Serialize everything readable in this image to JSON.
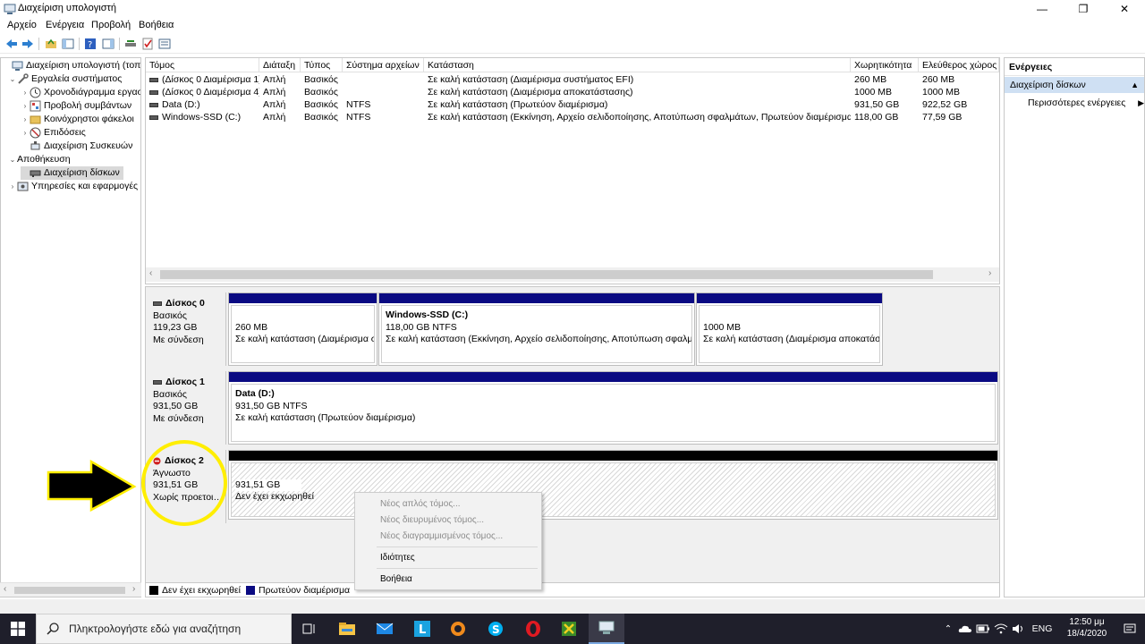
{
  "window": {
    "title": "Διαχείριση υπολογιστή"
  },
  "menu": [
    "Αρχείο",
    "Ενέργεια",
    "Προβολή",
    "Βοήθεια"
  ],
  "tree": {
    "items": [
      {
        "label": "Διαχείριση υπολογιστή (τοπικά)",
        "level": 0,
        "exp": ""
      },
      {
        "label": "Εργαλεία συστήματος",
        "level": 1,
        "exp": "⌄"
      },
      {
        "label": "Χρονοδιάγραμμα εργασιών",
        "level": 2,
        "exp": "›"
      },
      {
        "label": "Προβολή συμβάντων",
        "level": 2,
        "exp": "›"
      },
      {
        "label": "Κοινόχρηστοι φάκελοι",
        "level": 2,
        "exp": "›"
      },
      {
        "label": "Επιδόσεις",
        "level": 2,
        "exp": "›"
      },
      {
        "label": "Διαχείριση Συσκευών",
        "level": 2,
        "exp": ""
      },
      {
        "label": "Αποθήκευση",
        "level": 1,
        "exp": "⌄"
      },
      {
        "label": "Διαχείριση δίσκων",
        "level": 2,
        "exp": "",
        "selected": true
      },
      {
        "label": "Υπηρεσίες και εφαρμογές",
        "level": 1,
        "exp": "›"
      }
    ]
  },
  "volumes": {
    "columns": [
      "Τόμος",
      "Διάταξη",
      "Τύπος",
      "Σύστημα αρχείων",
      "Κατάσταση",
      "Χωρητικότητα",
      "Ελεύθερος χώρος"
    ],
    "rows": [
      [
        "(Δίσκος 0 Διαμέρισμα 1)",
        "Απλή",
        "Βασικός",
        "",
        "Σε καλή κατάσταση (Διαμέρισμα συστήματος EFI)",
        "260 MB",
        "260 MB"
      ],
      [
        "(Δίσκος 0 Διαμέρισμα 4)",
        "Απλή",
        "Βασικός",
        "",
        "Σε καλή κατάσταση (Διαμέρισμα αποκατάστασης)",
        "1000 MB",
        "1000 MB"
      ],
      [
        "Data (D:)",
        "Απλή",
        "Βασικός",
        "NTFS",
        "Σε καλή κατάσταση (Πρωτεύον διαμέρισμα)",
        "931,50 GB",
        "922,52 GB"
      ],
      [
        "Windows-SSD (C:)",
        "Απλή",
        "Βασικός",
        "NTFS",
        "Σε καλή κατάσταση (Εκκίνηση, Αρχείο σελιδοποίησης, Αποτύπωση σφαλμάτων, Πρωτεύον διαμέρισμα)",
        "118,00 GB",
        "77,59 GB"
      ]
    ]
  },
  "disks": [
    {
      "name": "Δίσκος 0",
      "type": "Βασικός",
      "size": "119,23 GB",
      "status": "Με σύνδεση",
      "partitions": [
        {
          "name": "",
          "size": "260 MB",
          "status": "Σε καλή κατάσταση (Διαμέρισμα συστήματος EFI)"
        },
        {
          "name": "Windows-SSD  (C:)",
          "size": "118,00 GB NTFS",
          "status": "Σε καλή κατάσταση (Εκκίνηση, Αρχείο σελιδοποίησης, Αποτύπωση σφαλμάτων, Πρωτεύον διαμέρισμα)"
        },
        {
          "name": "",
          "size": "1000 MB",
          "status": "Σε καλή κατάσταση (Διαμέρισμα αποκατάστασης)"
        }
      ]
    },
    {
      "name": "Δίσκος 1",
      "type": "Βασικός",
      "size": "931,50 GB",
      "status": "Με σύνδεση",
      "partitions": [
        {
          "name": "Data  (D:)",
          "size": "931,50 GB NTFS",
          "status": "Σε καλή κατάσταση (Πρωτεύον διαμέρισμα)"
        }
      ]
    },
    {
      "name": "Δίσκος 2",
      "type": "Άγνωστο",
      "size": "931,51 GB",
      "status": "Χωρίς προετοιμασία",
      "partitions": [
        {
          "name": "",
          "size": "931,51 GB",
          "status": "Δεν έχει εκχωρηθεί"
        }
      ]
    }
  ],
  "legend": [
    {
      "label": "Δεν έχει εκχωρηθεί",
      "color": "#000000"
    },
    {
      "label": "Πρωτεύον διαμέρισμα",
      "color": "#0a0a82"
    }
  ],
  "actions": {
    "header": "Ενέργειες",
    "section": "Διαχείριση δίσκων",
    "more": "Περισσότερες ενέργειες"
  },
  "context_menu": {
    "new_simple": "Νέος απλός τόμος...",
    "new_spanned": "Νέος διευρυμένος τόμος...",
    "new_striped": "Νέος διαγραμμισμένος τόμος...",
    "properties": "Ιδιότητες",
    "help": "Βοήθεια"
  },
  "taskbar": {
    "search_placeholder": "Πληκτρολογήστε εδώ για αναζήτηση",
    "lang": "ENG",
    "time": "12:50 μμ",
    "date": "18/4/2020"
  },
  "colors": {
    "primary_partition": "#0a0a82",
    "annotation": "#ffee00",
    "selection": "#cfe0f3"
  }
}
